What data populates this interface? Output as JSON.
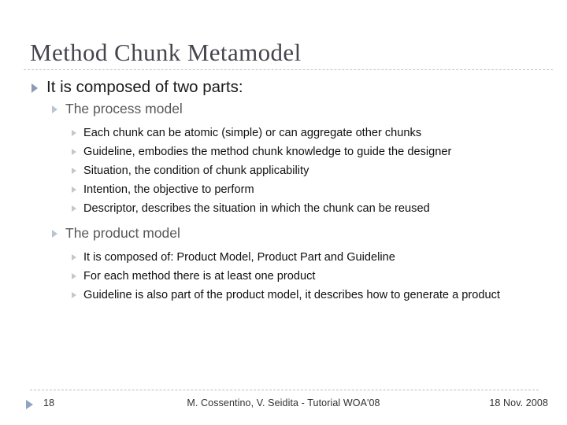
{
  "slide": {
    "title": "Method Chunk Metamodel",
    "accent_color": "#8c9bb4",
    "title_color": "#45454f",
    "rule_color": "#c8c8cc"
  },
  "content": {
    "level1": {
      "text": "It is composed of two parts:"
    },
    "sections": [
      {
        "heading": "The process model",
        "items": [
          "Each chunk can be atomic (simple) or can aggregate other chunks",
          "Guideline, embodies the method chunk knowledge to guide the designer",
          "Situation, the condition of chunk applicability",
          "Intention, the objective to perform",
          "Descriptor, describes the situation in which the chunk can be reused"
        ]
      },
      {
        "heading": "The product model",
        "items": [
          "It is composed of: Product Model, Product Part and Guideline",
          "For each method there is at least one product",
          "Guideline is also part of the product model, it describes how to generate a product"
        ]
      }
    ]
  },
  "footer": {
    "slide_number": "18",
    "center_text": "M. Cossentino, V. Seidita - Tutorial WOA'08",
    "date": "18 Nov. 2008",
    "marker_color": "#8fa4c0"
  }
}
